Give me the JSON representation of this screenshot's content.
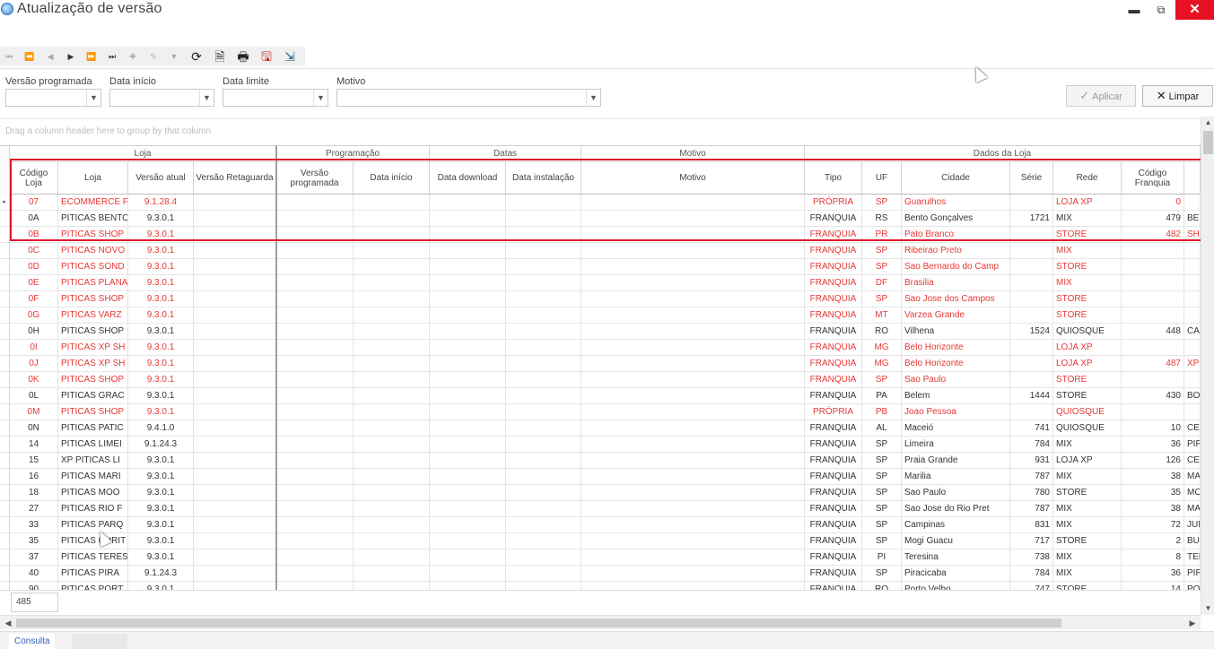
{
  "window": {
    "title": "Atualização de versão",
    "minimize": "▬",
    "maximize": "⧉",
    "close": "✕"
  },
  "toolbar": {
    "nav": [
      "⏮",
      "⏪",
      "◀",
      "▶",
      "⏩",
      "⏭",
      "✚",
      "✎",
      "▼"
    ],
    "icons": [
      "refresh-icon",
      "preview-icon",
      "print-icon",
      "export-icon",
      "exit-icon"
    ],
    "glyphs": [
      "⟳",
      "🗎",
      "🖶",
      "🖫",
      "⇲"
    ]
  },
  "filters": {
    "versao_programada": "Versão programada",
    "data_inicio": "Data início",
    "data_limite": "Data limite",
    "motivo": "Motivo",
    "aplicar": "Aplicar",
    "limpar": "Limpar"
  },
  "group_panel": {
    "hint": "Drag a column header here to group by that column"
  },
  "grid": {
    "bands": [
      "Loja",
      "Programação",
      "Datas",
      "Motivo",
      "Dados da Loja"
    ],
    "columns": [
      "Código Loja",
      "Loja",
      "Versão atual",
      "Versão Retaguarda",
      "Versão programada",
      "Data início",
      "Data download",
      "Data instalação",
      "Motivo",
      "Tipo",
      "UF",
      "Cidade",
      "Série",
      "Rede",
      "Código Franquia",
      ""
    ],
    "rows": [
      {
        "codigo": "07",
        "loja": "ECOMMERCE F",
        "versao": "9.1.28.4",
        "tipo": "PRÓPRIA",
        "uf": "SP",
        "cidade": "Guarulhos",
        "serie": "",
        "rede": "LOJA XP",
        "franquia": "0",
        "extra": "",
        "color": "red"
      },
      {
        "codigo": "0A",
        "loja": "PITICAS BENTO",
        "versao": "9.3.0.1",
        "tipo": "FRANQUIA",
        "uf": "RS",
        "cidade": "Bento Gonçalves",
        "serie": "1721",
        "rede": "MIX",
        "franquia": "479",
        "extra": "BEN",
        "color": "black"
      },
      {
        "codigo": "0B",
        "loja": "PITICAS SHOP",
        "versao": "9.3.0.1",
        "tipo": "FRANQUIA",
        "uf": "PR",
        "cidade": "Pato Branco",
        "serie": "",
        "rede": "STORE",
        "franquia": "482",
        "extra": "SHO",
        "color": "red"
      },
      {
        "codigo": "0C",
        "loja": "PITICAS NOVO",
        "versao": "9.3.0.1",
        "tipo": "FRANQUIA",
        "uf": "SP",
        "cidade": "Ribeirao Preto",
        "serie": "",
        "rede": "MIX",
        "franquia": "",
        "extra": "",
        "color": "red"
      },
      {
        "codigo": "0D",
        "loja": "PITICAS SOND",
        "versao": "9.3.0.1",
        "tipo": "FRANQUIA",
        "uf": "SP",
        "cidade": "Sao Bernardo do Camp",
        "serie": "",
        "rede": "STORE",
        "franquia": "",
        "extra": "",
        "color": "red"
      },
      {
        "codigo": "0E",
        "loja": "PITICAS PLANA",
        "versao": "9.3.0.1",
        "tipo": "FRANQUIA",
        "uf": "DF",
        "cidade": "Brasilia",
        "serie": "",
        "rede": "MIX",
        "franquia": "",
        "extra": "",
        "color": "red"
      },
      {
        "codigo": "0F",
        "loja": "PITICAS SHOP",
        "versao": "9.3.0.1",
        "tipo": "FRANQUIA",
        "uf": "SP",
        "cidade": "Sao Jose dos Campos",
        "serie": "",
        "rede": "STORE",
        "franquia": "",
        "extra": "",
        "color": "red"
      },
      {
        "codigo": "0G",
        "loja": "PITICAS VARZ",
        "versao": "9.3.0.1",
        "tipo": "FRANQUIA",
        "uf": "MT",
        "cidade": "Varzea Grande",
        "serie": "",
        "rede": "STORE",
        "franquia": "",
        "extra": "",
        "color": "red"
      },
      {
        "codigo": "0H",
        "loja": "PITICAS SHOP",
        "versao": "9.3.0.1",
        "tipo": "FRANQUIA",
        "uf": "RO",
        "cidade": "Vilhena",
        "serie": "1524",
        "rede": "QUIOSQUE",
        "franquia": "448",
        "extra": "CAC",
        "color": "black"
      },
      {
        "codigo": "0I",
        "loja": "PITICAS XP SH",
        "versao": "9.3.0.1",
        "tipo": "FRANQUIA",
        "uf": "MG",
        "cidade": "Belo Horizonte",
        "serie": "",
        "rede": "LOJA XP",
        "franquia": "",
        "extra": "",
        "color": "red"
      },
      {
        "codigo": "0J",
        "loja": "PITICAS XP SH",
        "versao": "9.3.0.1",
        "tipo": "FRANQUIA",
        "uf": "MG",
        "cidade": "Belo Horizonte",
        "serie": "",
        "rede": "LOJA XP",
        "franquia": "487",
        "extra": "XP S",
        "color": "red"
      },
      {
        "codigo": "0K",
        "loja": "PITICAS SHOP",
        "versao": "9.3.0.1",
        "tipo": "FRANQUIA",
        "uf": "SP",
        "cidade": "Sao Paulo",
        "serie": "",
        "rede": "STORE",
        "franquia": "",
        "extra": "",
        "color": "red"
      },
      {
        "codigo": "0L",
        "loja": "PITICAS GRAC",
        "versao": "9.3.0.1",
        "tipo": "FRANQUIA",
        "uf": "PA",
        "cidade": "Belem",
        "serie": "1444",
        "rede": "STORE",
        "franquia": "430",
        "extra": "BOL",
        "color": "black"
      },
      {
        "codigo": "0M",
        "loja": "PITICAS SHOP",
        "versao": "9.3.0.1",
        "tipo": "PRÓPRIA",
        "uf": "PB",
        "cidade": "Joao Pessoa",
        "serie": "",
        "rede": "QUIOSQUE",
        "franquia": "",
        "extra": "",
        "color": "red"
      },
      {
        "codigo": "0N",
        "loja": "PITICAS PATIC",
        "versao": "9.4.1.0",
        "tipo": "FRANQUIA",
        "uf": "AL",
        "cidade": "Maceió",
        "serie": "741",
        "rede": "QUIOSQUE",
        "franquia": "10",
        "extra": "CEN",
        "color": "black"
      },
      {
        "codigo": "14",
        "loja": "PITICAS LIMEI",
        "versao": "9.1.24.3",
        "tipo": "FRANQUIA",
        "uf": "SP",
        "cidade": "Limeira",
        "serie": "784",
        "rede": "MIX",
        "franquia": "36",
        "extra": "PIR",
        "color": "black"
      },
      {
        "codigo": "15",
        "loja": "XP PITICAS LI",
        "versao": "9.3.0.1",
        "tipo": "FRANQUIA",
        "uf": "SP",
        "cidade": "Praia Grande",
        "serie": "931",
        "rede": "LOJA XP",
        "franquia": "126",
        "extra": "CEN",
        "color": "black"
      },
      {
        "codigo": "16",
        "loja": "PITICAS MARI",
        "versao": "9.3.0.1",
        "tipo": "FRANQUIA",
        "uf": "SP",
        "cidade": "Marilia",
        "serie": "787",
        "rede": "MIX",
        "franquia": "38",
        "extra": "MAR",
        "color": "black"
      },
      {
        "codigo": "18",
        "loja": "PITICAS MOO",
        "versao": "9.3.0.1",
        "tipo": "FRANQUIA",
        "uf": "SP",
        "cidade": "Sao Paulo",
        "serie": "780",
        "rede": "STORE",
        "franquia": "35",
        "extra": "MO",
        "color": "black"
      },
      {
        "codigo": "27",
        "loja": "PITICAS RIO F",
        "versao": "9.3.0.1",
        "tipo": "FRANQUIA",
        "uf": "SP",
        "cidade": "Sao Jose do Rio Pret",
        "serie": "787",
        "rede": "MIX",
        "franquia": "38",
        "extra": "MAR",
        "color": "black"
      },
      {
        "codigo": "33",
        "loja": "PITICAS PARQ",
        "versao": "9.3.0.1",
        "tipo": "FRANQUIA",
        "uf": "SP",
        "cidade": "Campinas",
        "serie": "831",
        "rede": "MIX",
        "franquia": "72",
        "extra": "JUN",
        "color": "black"
      },
      {
        "codigo": "35",
        "loja": "PITICAS CURIT",
        "versao": "9.3.0.1",
        "tipo": "FRANQUIA",
        "uf": "SP",
        "cidade": "Mogi Guacu",
        "serie": "717",
        "rede": "STORE",
        "franquia": "2",
        "extra": "BUF",
        "color": "black"
      },
      {
        "codigo": "37",
        "loja": "PITICAS TERES",
        "versao": "9.3.0.1",
        "tipo": "FRANQUIA",
        "uf": "PI",
        "cidade": "Teresina",
        "serie": "738",
        "rede": "MIX",
        "franquia": "8",
        "extra": "TER",
        "color": "black"
      },
      {
        "codigo": "40",
        "loja": "PITICAS PIRA",
        "versao": "9.1.24.3",
        "tipo": "FRANQUIA",
        "uf": "SP",
        "cidade": "Piracicaba",
        "serie": "784",
        "rede": "MIX",
        "franquia": "36",
        "extra": "PIR",
        "color": "black"
      },
      {
        "codigo": "90",
        "loja": "PITICAS PORT",
        "versao": "9.3.0.1",
        "tipo": "FRANQUIA",
        "uf": "RO",
        "cidade": "Porto Velho",
        "serie": "747",
        "rede": "STORE",
        "franquia": "14",
        "extra": "POR",
        "color": "black"
      }
    ]
  },
  "footer": {
    "count": "485"
  },
  "tabs": {
    "consulta": "Consulta"
  },
  "colors": {
    "highlight": "#e0182d",
    "red_text": "#e53935",
    "close_button": "#e81123"
  }
}
